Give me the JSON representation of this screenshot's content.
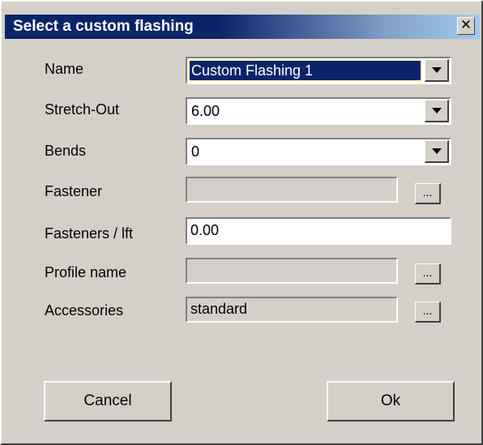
{
  "dialog": {
    "title": "Select a custom flashing",
    "close_label": "✕"
  },
  "form": {
    "name": {
      "label": "Name",
      "value": "Custom Flashing 1"
    },
    "stretch_out": {
      "label": "Stretch-Out",
      "value": "6.00"
    },
    "bends": {
      "label": "Bends",
      "value": "0"
    },
    "fastener": {
      "label": "Fastener",
      "value": "",
      "browse_label": "..."
    },
    "fasteners_per_lft": {
      "label": "Fasteners / lft",
      "value": "0.00"
    },
    "profile_name": {
      "label": "Profile name",
      "value": "",
      "browse_label": "..."
    },
    "accessories": {
      "label": "Accessories",
      "value": "standard",
      "browse_label": "..."
    }
  },
  "buttons": {
    "cancel_label": "Cancel",
    "ok_label": "Ok"
  },
  "colors": {
    "title_bar": "#0a246a",
    "dialog_face": "#d4d0c8",
    "selection": "#0a246a"
  }
}
